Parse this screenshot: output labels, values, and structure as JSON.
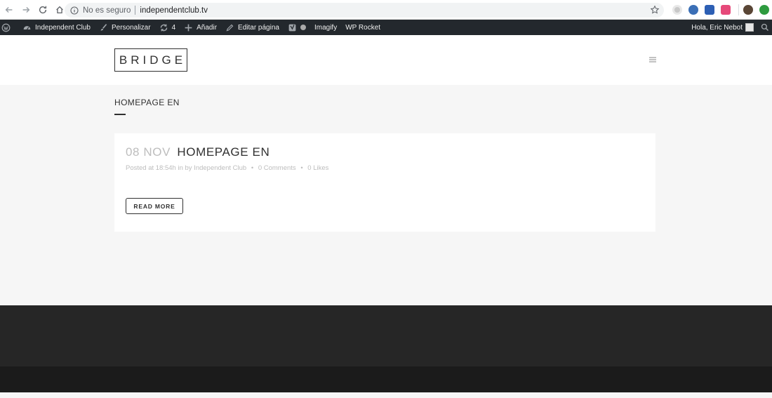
{
  "browser": {
    "insecure_label": "No es seguro",
    "url": "independentclub.tv"
  },
  "admin_bar": {
    "site_name": "Independent Club",
    "customize": "Personalizar",
    "updates_count": "4",
    "add_new": "Añadir",
    "edit_page": "Editar página",
    "imagify": "Imagify",
    "wp_rocket": "WP Rocket",
    "greeting": "Hola, Eric Nebot"
  },
  "header": {
    "logo_text": "BRIDGE"
  },
  "page": {
    "title": "HOMEPAGE EN"
  },
  "post": {
    "date": "08 NOV",
    "title": "HOMEPAGE EN",
    "meta_posted": "Posted at 18:54h in by",
    "meta_author": "Independent Club",
    "meta_comments": "0 Comments",
    "meta_likes": "0 Likes",
    "read_more": "READ MORE"
  },
  "colors": {
    "admin_bar_bg": "#23282d",
    "content_bg": "#f6f6f6",
    "footer_top": "#262626",
    "footer_bottom": "#1b1b1b",
    "date_gray": "#bdbdbd",
    "text_dark": "#303030"
  }
}
